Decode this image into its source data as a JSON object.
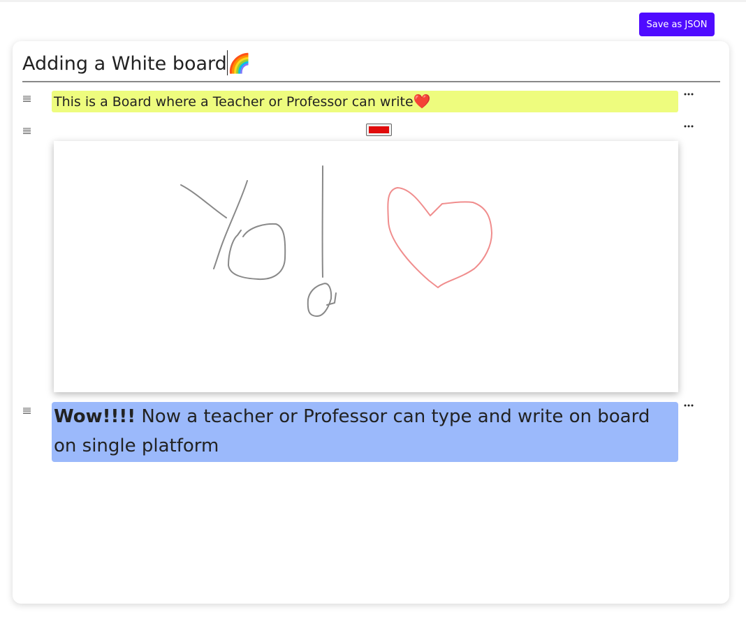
{
  "toolbar": {
    "save_label": "Save as JSON"
  },
  "document": {
    "title": "Adding a White board",
    "title_emoji": "🌈",
    "blocks": [
      {
        "type": "text",
        "text": "This is a Board where a Teacher or Professor can write",
        "emoji": "❤️",
        "background": "#eefc7e"
      },
      {
        "type": "whiteboard",
        "pen_color": "#e10b0b",
        "strokes": [
          {
            "color": "#888888",
            "description": "Yo"
          },
          {
            "color": "#888888",
            "description": "exclamation mark"
          },
          {
            "color": "#f08d8d",
            "description": "heart"
          }
        ]
      },
      {
        "type": "text",
        "bold_text": "Wow!!!!",
        "text": " Now a teacher or Professor can type and write on board on single platform",
        "background": "#9bb9fb"
      }
    ]
  },
  "colors": {
    "accent": "#4f0bff",
    "pen_red": "#e10b0b"
  },
  "icons": {
    "drag_handle": "drag-handle-icon",
    "more_menu": "more-icon"
  }
}
